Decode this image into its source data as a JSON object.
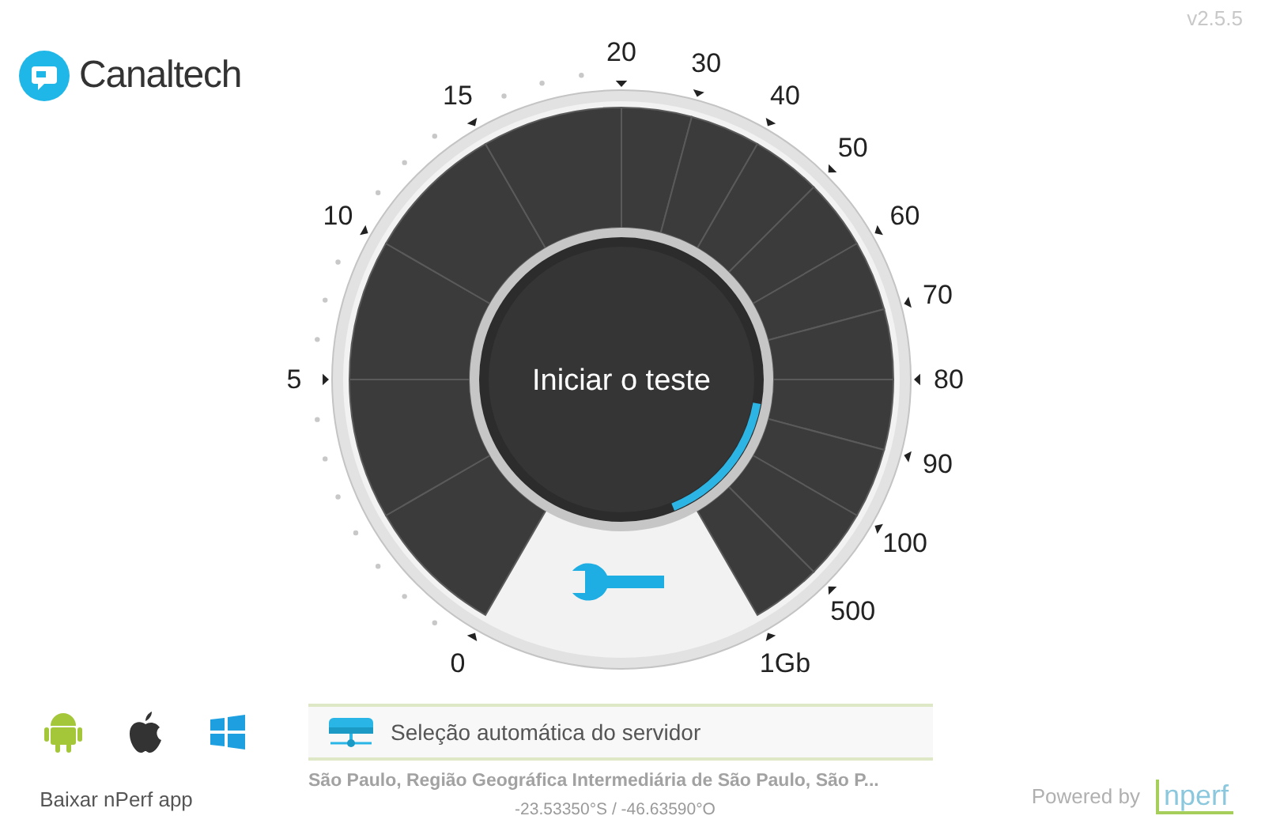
{
  "logo": {
    "text": "Canaltech"
  },
  "version": "v2.5.5",
  "gauge": {
    "scale": [
      "0",
      "5",
      "10",
      "15",
      "20",
      "30",
      "40",
      "50",
      "60",
      "70",
      "80",
      "90",
      "100",
      "500",
      "1Gb"
    ],
    "start_label": "Iniciar o teste"
  },
  "apps": {
    "platforms": [
      {
        "kind": "android"
      },
      {
        "kind": "apple"
      },
      {
        "kind": "windows"
      }
    ],
    "label": "Baixar nPerf app"
  },
  "server": {
    "label": "Seleção automática do servidor",
    "location": "São Paulo, Região Geográfica Intermediária de São Paulo, São P...",
    "coordinates": "-23.53350°S / -46.63590°O"
  },
  "powered_by": {
    "text": "Powered by",
    "brand": "nperf"
  }
}
